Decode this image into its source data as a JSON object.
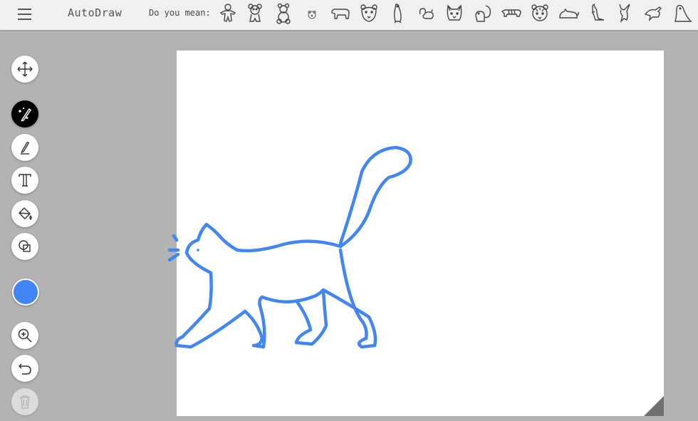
{
  "header": {
    "app_title": "AutoDraw",
    "suggest_label": "Do you mean:",
    "menu_icon": "hamburger-menu-icon"
  },
  "suggestions": [
    {
      "name": "gingerbread-man-icon"
    },
    {
      "name": "bear-icon"
    },
    {
      "name": "teddy-bear-icon"
    },
    {
      "name": "polar-bear-icon"
    },
    {
      "name": "bear-walking-icon"
    },
    {
      "name": "bear-face-icon"
    },
    {
      "name": "penguin-icon"
    },
    {
      "name": "squirrel-icon"
    },
    {
      "name": "cat-face-icon"
    },
    {
      "name": "squirrel-2-icon"
    },
    {
      "name": "tiger-icon"
    },
    {
      "name": "tiger-face-icon"
    },
    {
      "name": "cat-lying-icon"
    },
    {
      "name": "kangaroo-icon"
    },
    {
      "name": "kangaroo-2-icon"
    },
    {
      "name": "bird-icon"
    },
    {
      "name": "seal-icon"
    }
  ],
  "toolbar": {
    "tools": [
      {
        "name": "move-tool",
        "icon": "move-arrows-icon"
      },
      {
        "name": "autodraw-tool",
        "icon": "magic-pencil-icon",
        "active": true
      },
      {
        "name": "draw-tool",
        "icon": "pencil-icon"
      },
      {
        "name": "type-tool",
        "icon": "text-t-icon"
      },
      {
        "name": "fill-tool",
        "icon": "paint-bucket-icon"
      },
      {
        "name": "shape-tool",
        "icon": "shapes-icon"
      },
      {
        "name": "zoom-tool",
        "icon": "zoom-in-icon"
      },
      {
        "name": "undo-tool",
        "icon": "undo-icon"
      },
      {
        "name": "delete-tool",
        "icon": "trash-icon",
        "disabled": true
      }
    ],
    "current_color": "#4285f4"
  },
  "canvas": {
    "background": "#ffffff",
    "stroke_color": "#4285f4",
    "drawing_subject": "cat"
  }
}
